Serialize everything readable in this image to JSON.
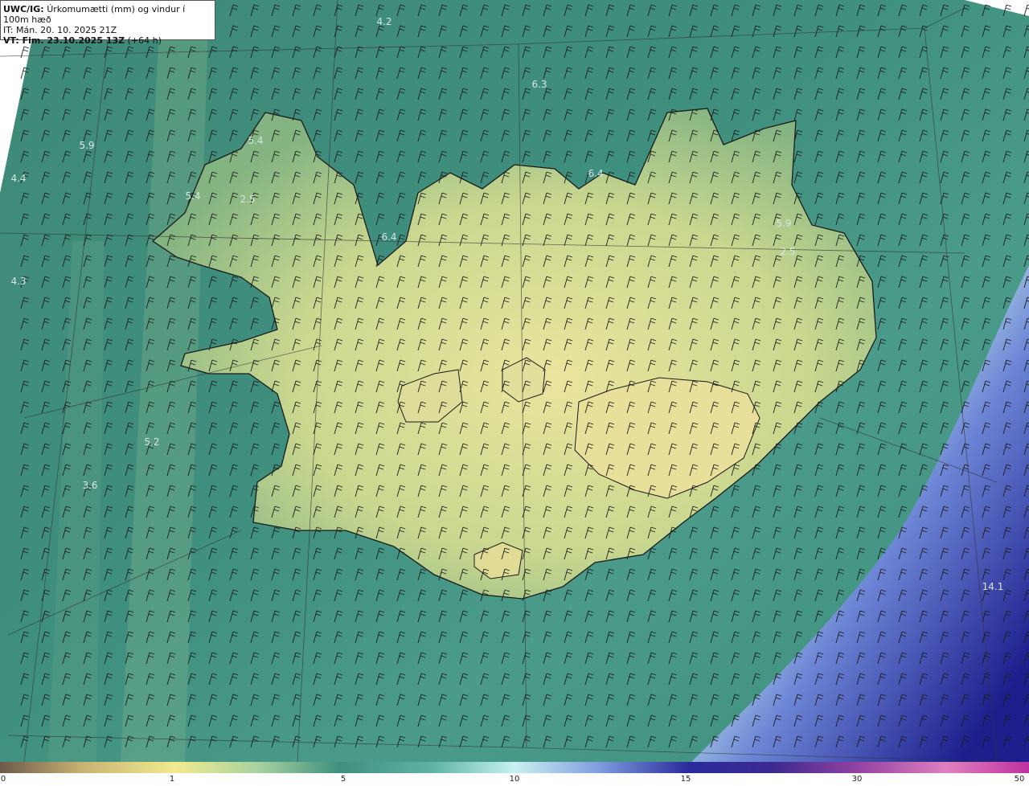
{
  "header": {
    "product_prefix": "UWC/IG:",
    "product_title": "Úrkomumætti (mm) og vindur í 100m hæð",
    "init_time": "IT: Mán. 20. 10. 2025 21Z",
    "valid_prefix": "VT: Fim. 23.10.2025 13Z",
    "valid_suffix": "(+64 h)"
  },
  "values": [
    "4.2",
    "6.3",
    "5.9",
    "5.4",
    "4.4",
    "5.4",
    "2.5",
    "6.4",
    "6.4",
    "5.9",
    "2.5",
    "4.3",
    "5.2",
    "3.6",
    "14.1"
  ],
  "colorbar": {
    "ticks": [
      "0",
      "1",
      "5",
      "10",
      "15",
      "30",
      "50"
    ],
    "colors": [
      "#6b5a4a",
      "#c8b373",
      "#f2ea8e",
      "#a8d3a0",
      "#3f8f7e",
      "#5fb3a6",
      "#c6f2ef",
      "#7fa0e0",
      "#2a2a9a",
      "#3a2a90",
      "#9040a0",
      "#e080c0",
      "#c030a0"
    ]
  },
  "palette": {
    "ocean_low": "#3f8f7e",
    "land_low": "#c8d890",
    "land_high": "#e6e49a",
    "heavy_precip": "#2b2f9f"
  }
}
